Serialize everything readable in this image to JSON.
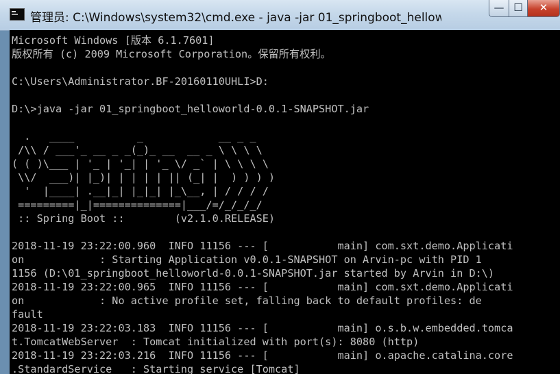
{
  "window": {
    "title": "管理员: C:\\Windows\\system32\\cmd.exe - java  -jar 01_springboot_hellow...",
    "minimize_label": "—",
    "maximize_label": "☐",
    "close_label": "✕"
  },
  "console": {
    "lines": [
      "Microsoft Windows [版本 6.1.7601]",
      "版权所有 (c) 2009 Microsoft Corporation。保留所有权利。",
      "",
      "C:\\Users\\Administrator.BF-20160110UHLI>D:",
      "",
      "D:\\>java -jar 01_springboot_helloworld-0.0.1-SNAPSHOT.jar",
      "",
      "  .   ____          _            __ _ _",
      " /\\\\ / ___'_ __ _ _(_)_ __  __ _ \\ \\ \\ \\",
      "( ( )\\___ | '_ | '_| | '_ \\/ _` | \\ \\ \\ \\",
      " \\\\/  ___)| |_)| | | | | || (_| |  ) ) ) )",
      "  '  |____| .__|_| |_|_| |_\\__, | / / / /",
      " =========|_|==============|___/=/_/_/_/",
      " :: Spring Boot ::        (v2.1.0.RELEASE)",
      "",
      "2018-11-19 23:22:00.960  INFO 11156 --- [           main] com.sxt.demo.Applicati",
      "on            : Starting Application v0.0.1-SNAPSHOT on Arvin-pc with PID 1",
      "1156 (D:\\01_springboot_helloworld-0.0.1-SNAPSHOT.jar started by Arvin in D:\\)",
      "2018-11-19 23:22:00.965  INFO 11156 --- [           main] com.sxt.demo.Applicati",
      "on            : No active profile set, falling back to default profiles: de",
      "fault",
      "2018-11-19 23:22:03.183  INFO 11156 --- [           main] o.s.b.w.embedded.tomca",
      "t.TomcatWebServer  : Tomcat initialized with port(s): 8080 (http)",
      "2018-11-19 23:22:03.216  INFO 11156 --- [           main] o.apache.catalina.core",
      ".StandardService   : Starting service [Tomcat]"
    ]
  }
}
